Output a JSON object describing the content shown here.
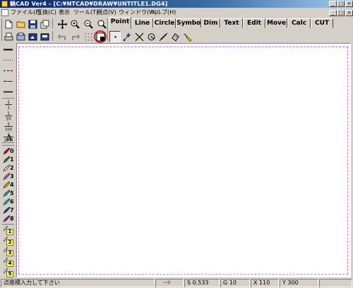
{
  "window": {
    "title": "鍋CAD Ver4 - [C:¥NTCAD¥DRAW¥UNTITLE1.DG4]",
    "controls": [
      "_",
      "□",
      "×"
    ],
    "mdi_controls": [
      "_",
      "□",
      "×"
    ]
  },
  "menu": {
    "items": [
      "ファイル(F)",
      "互換(C)",
      "表示",
      "ツール(T)",
      "視点(V)",
      "ウィンドウ(W)",
      "ヘルプ(H)"
    ]
  },
  "tabs": [
    "Point",
    "Line",
    "Circle",
    "Symbol",
    "Dim",
    "Text",
    "Edit",
    "Move",
    "Calc",
    "CUT"
  ],
  "active_tab": "Point",
  "left_toolbar": {
    "scale_labels": [
      "1/1",
      "1/10",
      "1/100",
      "1/1000"
    ],
    "text_tool": "A",
    "pens": [
      "0",
      "1",
      "2",
      "3",
      "4",
      "5",
      "6",
      "7",
      "8"
    ],
    "pen_colors": [
      "#d01010",
      "#2a8a2a",
      "#e8e8e8",
      "#d060d0",
      "#e0c000",
      "#30a0e0",
      "#20c0c0",
      "#4040c0",
      "#a030a0"
    ],
    "layers": [
      "1",
      "2",
      "3",
      "4",
      "5"
    ]
  },
  "status": {
    "message": "点座標入力して下さい",
    "s": "S 0.533",
    "g": "G 10",
    "x": "X 110",
    "y": "Y 300"
  }
}
